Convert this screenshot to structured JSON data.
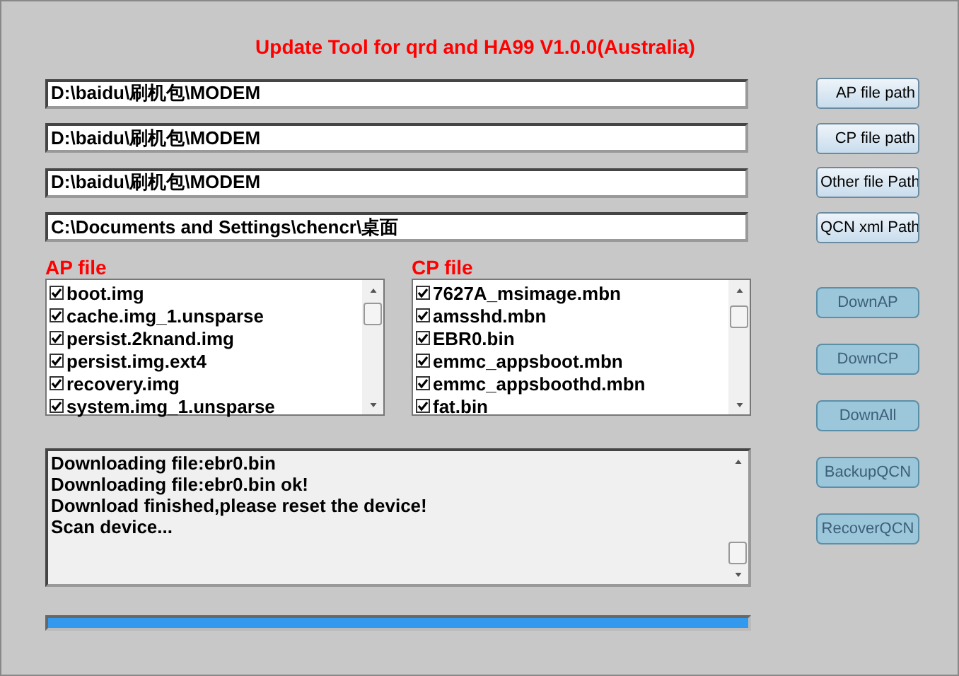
{
  "title": "Update Tool for qrd and HA99 V1.0.0(Australia)",
  "paths": [
    {
      "value": "D:\\baidu\\刷机包\\MODEM",
      "button": "AP file path"
    },
    {
      "value": "D:\\baidu\\刷机包\\MODEM",
      "button": "CP file path"
    },
    {
      "value": "D:\\baidu\\刷机包\\MODEM",
      "button": "Other file Path"
    },
    {
      "value": "C:\\Documents and Settings\\chencr\\桌面",
      "button": "QCN xml Path"
    }
  ],
  "lists": [
    {
      "label": "AP file",
      "items": [
        {
          "name": "boot.img",
          "checked": true
        },
        {
          "name": "cache.img_1.unsparse",
          "checked": true
        },
        {
          "name": "persist.2knand.img",
          "checked": true
        },
        {
          "name": "persist.img.ext4",
          "checked": true
        },
        {
          "name": "recovery.img",
          "checked": true
        },
        {
          "name": "system.img_1.unsparse",
          "checked": true
        }
      ]
    },
    {
      "label": "CP file",
      "items": [
        {
          "name": "7627A_msimage.mbn",
          "checked": true
        },
        {
          "name": "amsshd.mbn",
          "checked": true
        },
        {
          "name": "EBR0.bin",
          "checked": true
        },
        {
          "name": "emmc_appsboot.mbn",
          "checked": true
        },
        {
          "name": "emmc_appsboothd.mbn",
          "checked": true
        },
        {
          "name": "fat.bin",
          "checked": true
        }
      ]
    }
  ],
  "log": [
    "Downloading file:ebr0.bin",
    "Downloading file:ebr0.bin ok!",
    "Download finished,please reset the device!",
    "Scan device..."
  ],
  "progress": {
    "level": 1
  },
  "actions": [
    {
      "label": "DownAP",
      "disabled": true
    },
    {
      "label": "DownCP",
      "disabled": true
    },
    {
      "label": "DownAll",
      "disabled": true
    },
    {
      "label": "BackupQCN",
      "disabled": true
    },
    {
      "label": "RecoverQCN",
      "disabled": true
    }
  ]
}
